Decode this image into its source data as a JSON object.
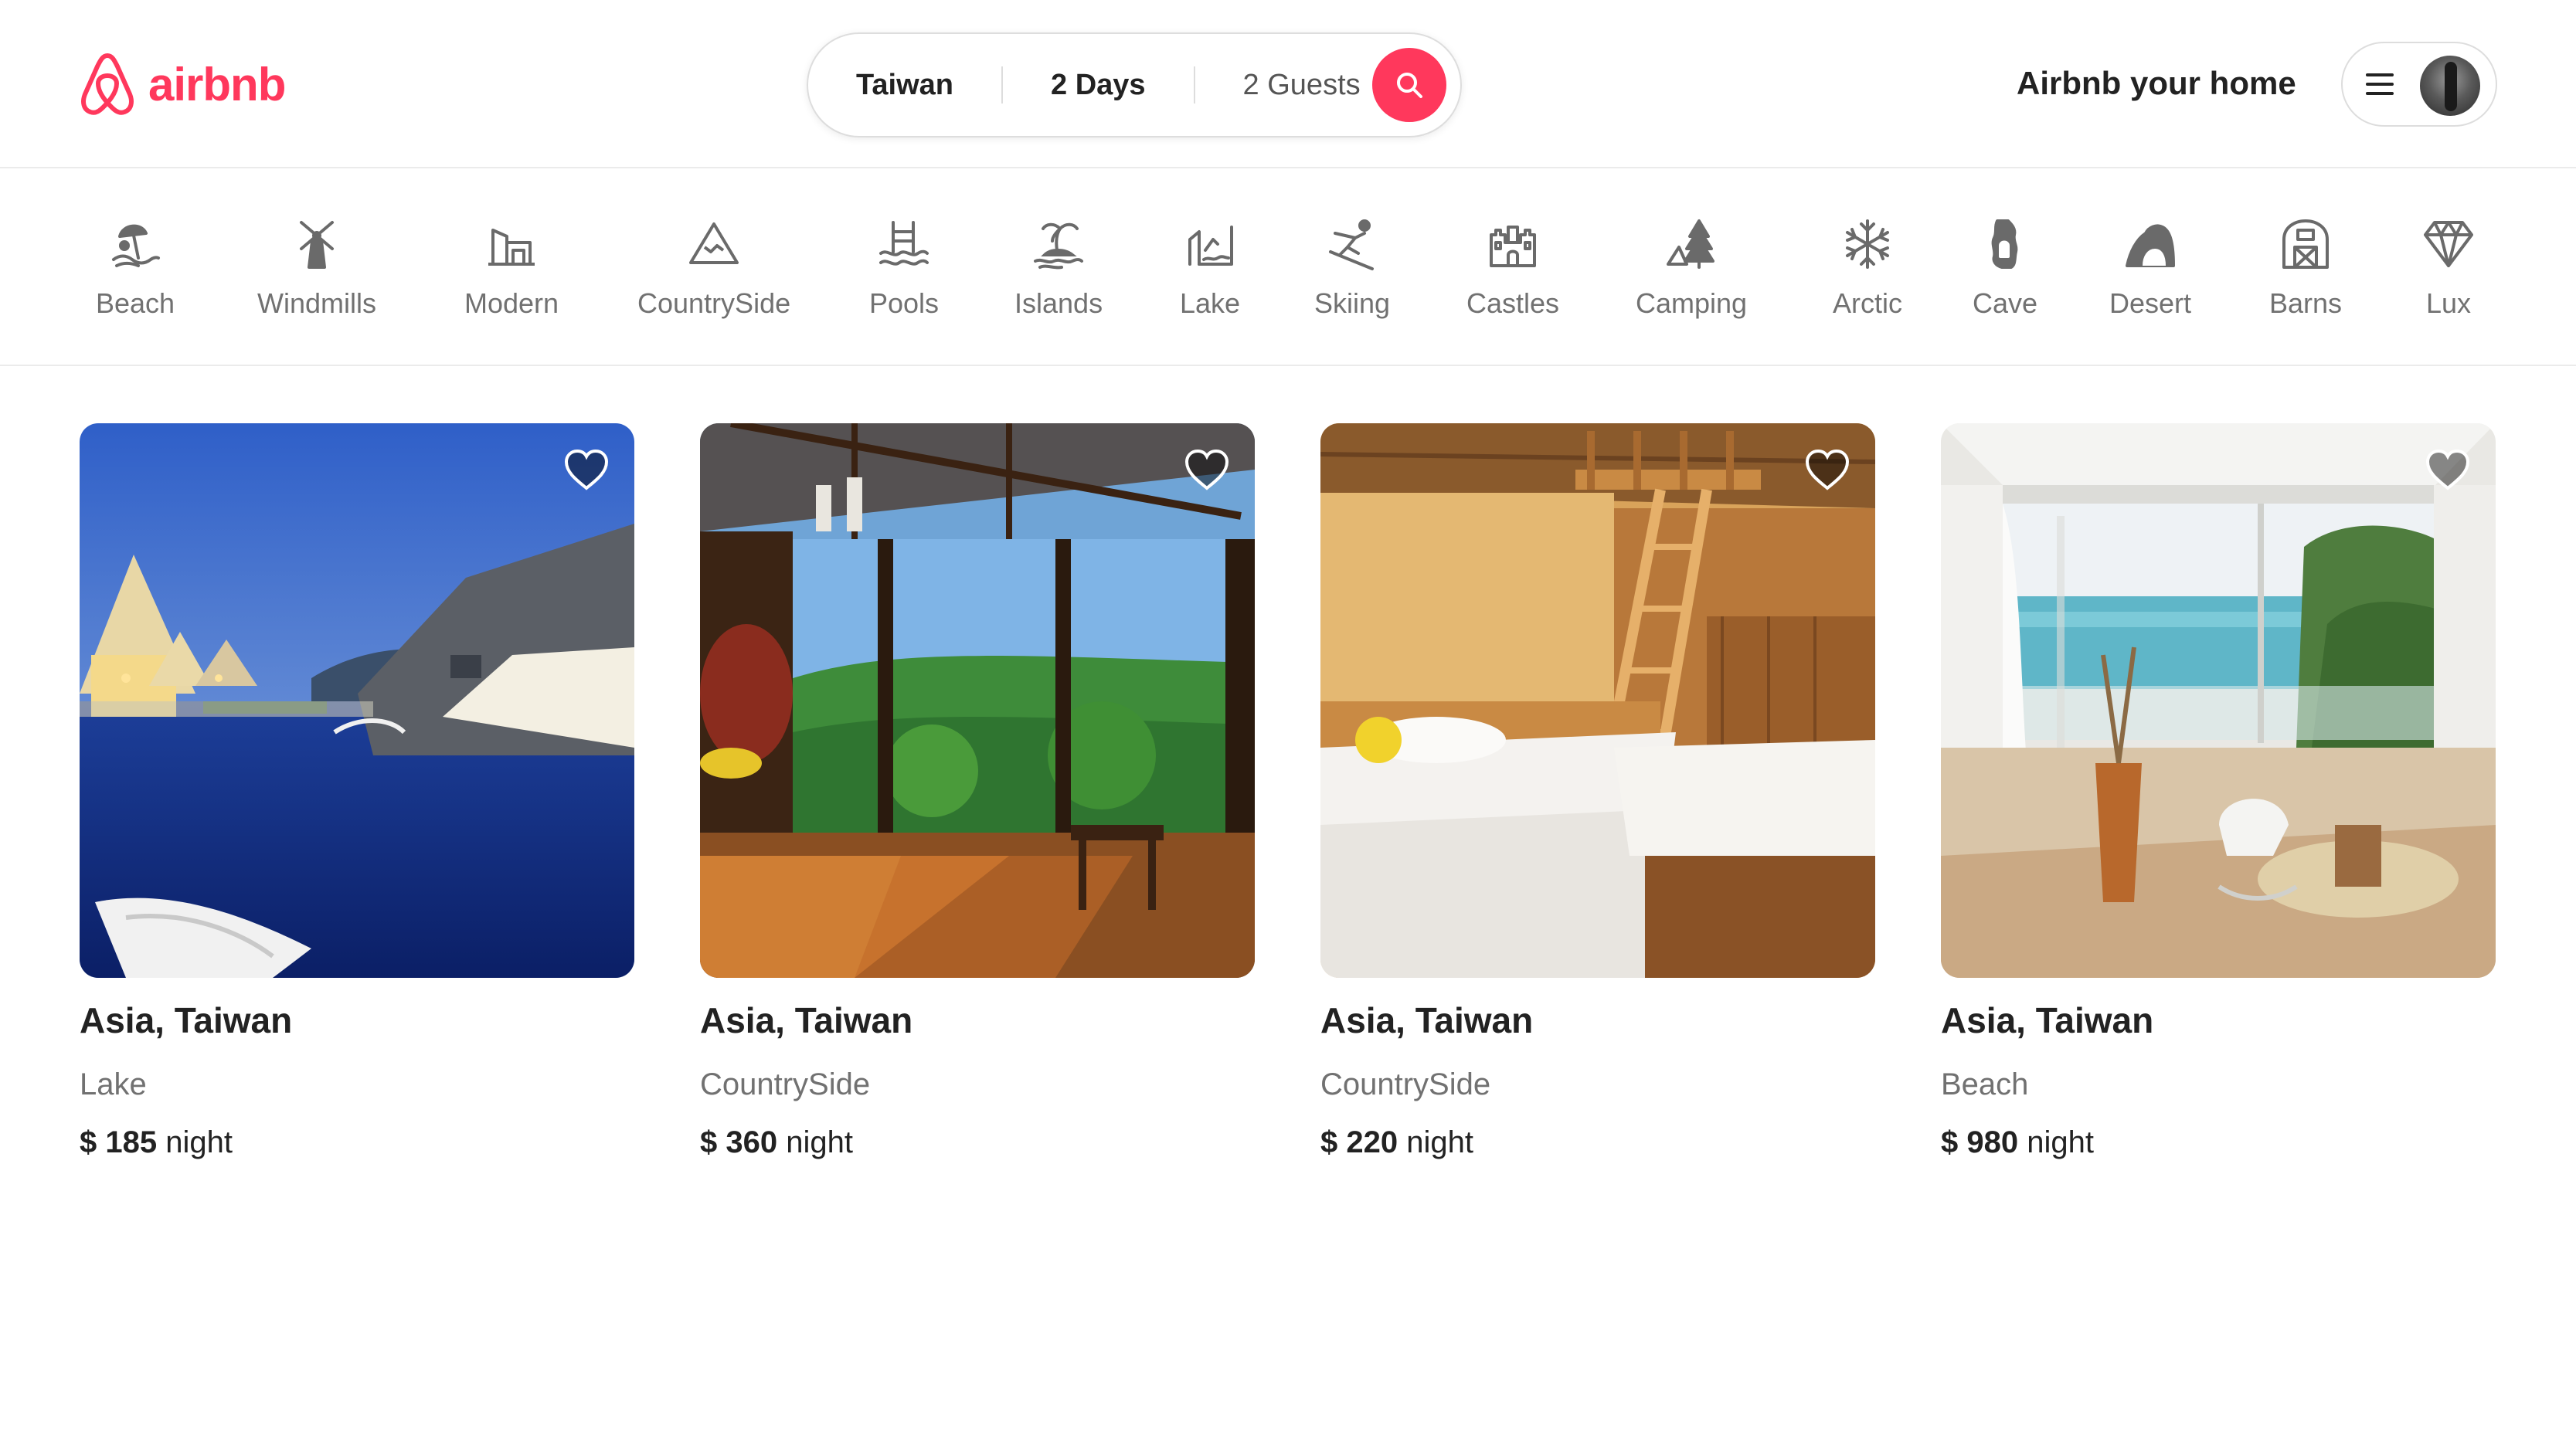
{
  "header": {
    "logo_text": "airbnb",
    "search": {
      "location": "Taiwan",
      "duration": "2 Days",
      "guests": "2 Guests"
    },
    "host_link": "Airbnb your home"
  },
  "colors": {
    "brand": "#ff385c",
    "text": "#222222",
    "muted": "#717171"
  },
  "categories": [
    {
      "label": "Beach",
      "icon": "beach-icon"
    },
    {
      "label": "Windmills",
      "icon": "windmill-icon"
    },
    {
      "label": "Modern",
      "icon": "modern-house-icon"
    },
    {
      "label": "CountrySide",
      "icon": "mountain-icon"
    },
    {
      "label": "Pools",
      "icon": "pool-icon"
    },
    {
      "label": "Islands",
      "icon": "island-icon"
    },
    {
      "label": "Lake",
      "icon": "lake-icon"
    },
    {
      "label": "Skiing",
      "icon": "skiing-icon"
    },
    {
      "label": "Castles",
      "icon": "castle-icon"
    },
    {
      "label": "Camping",
      "icon": "camping-icon"
    },
    {
      "label": "Arctic",
      "icon": "snowflake-icon"
    },
    {
      "label": "Cave",
      "icon": "cave-icon"
    },
    {
      "label": "Desert",
      "icon": "desert-icon"
    },
    {
      "label": "Barns",
      "icon": "barn-icon"
    },
    {
      "label": "Lux",
      "icon": "diamond-icon"
    }
  ],
  "listings": [
    {
      "title": "Asia, Taiwan",
      "type": "Lake",
      "price": "$ 185",
      "unit": "night",
      "image": "lakeside-chalets-at-dusk"
    },
    {
      "title": "Asia, Taiwan",
      "type": "CountrySide",
      "price": "$ 360",
      "unit": "night",
      "image": "glass-sunroom-forest-view"
    },
    {
      "title": "Asia, Taiwan",
      "type": "CountrySide",
      "price": "$ 220",
      "unit": "night",
      "image": "wooden-loft-bedroom"
    },
    {
      "title": "Asia, Taiwan",
      "type": "Beach",
      "price": "$ 980",
      "unit": "night",
      "image": "sea-view-living-room"
    }
  ]
}
